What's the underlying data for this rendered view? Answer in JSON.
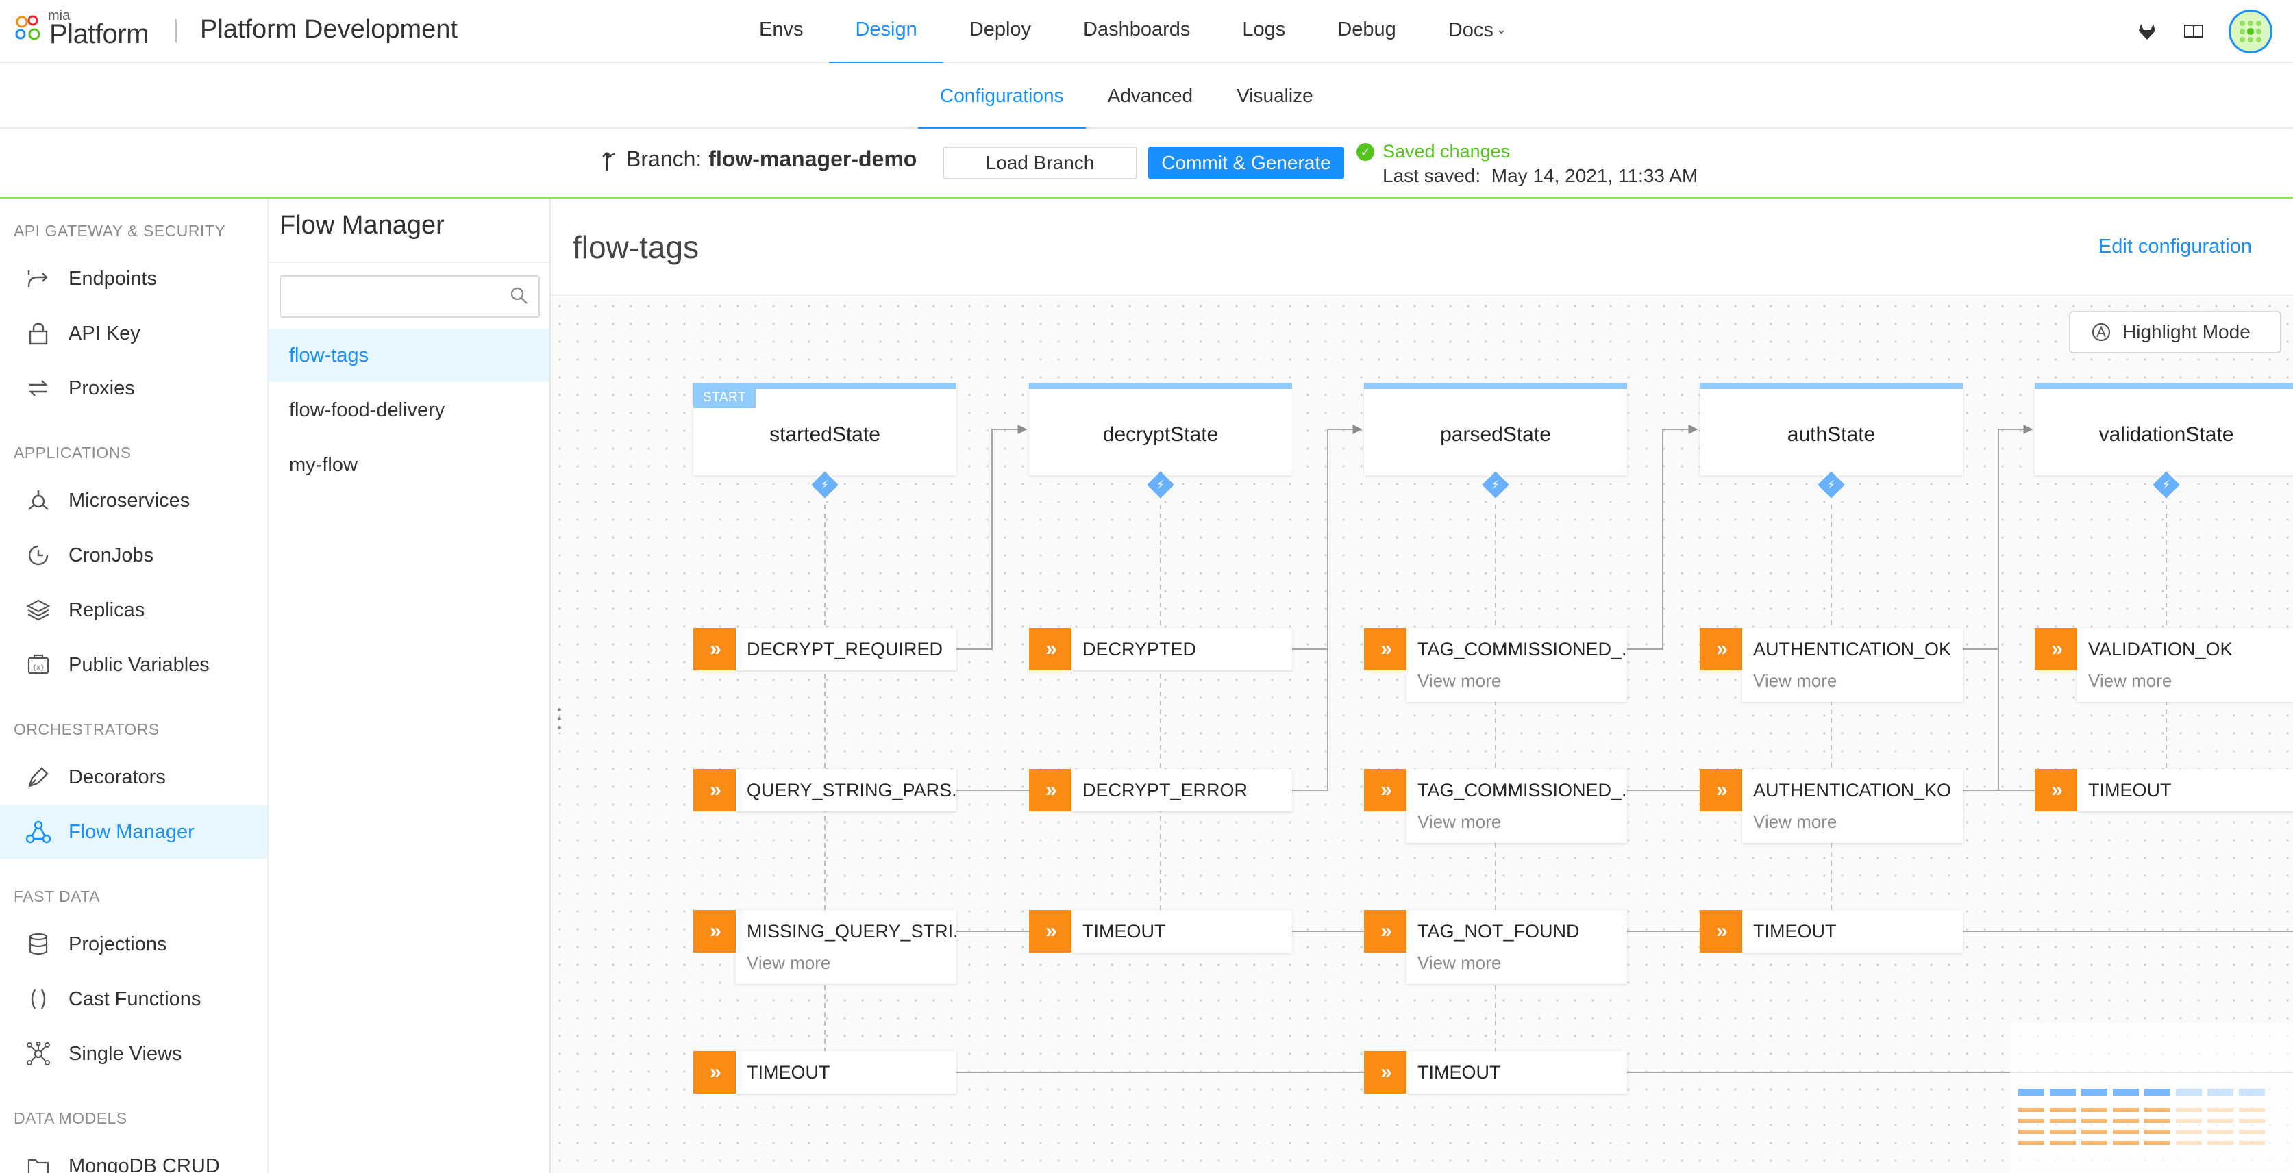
{
  "header": {
    "logo_small": "mia",
    "logo_main": "Platform",
    "project": "Platform Development",
    "nav": [
      "Envs",
      "Design",
      "Deploy",
      "Dashboards",
      "Logs",
      "Debug",
      "Docs"
    ],
    "nav_active": "Design",
    "icons": [
      "gitlab-icon",
      "book-icon",
      "avatar"
    ]
  },
  "subtabs": {
    "items": [
      "Configurations",
      "Advanced",
      "Visualize"
    ],
    "active": "Configurations"
  },
  "branch": {
    "label": "Branch:",
    "name": "flow-manager-demo",
    "load_label": "Load Branch",
    "commit_label": "Commit & Generate",
    "saved_text": "Saved changes",
    "last_saved_label": "Last saved:",
    "last_saved_value": "May 14, 2021, 11:33 AM"
  },
  "sidebar": {
    "sections": [
      {
        "title": "API GATEWAY & SECURITY",
        "items": [
          "Endpoints",
          "API Key",
          "Proxies"
        ]
      },
      {
        "title": "APPLICATIONS",
        "items": [
          "Microservices",
          "CronJobs",
          "Replicas",
          "Public Variables"
        ]
      },
      {
        "title": "ORCHESTRATORS",
        "items": [
          "Decorators",
          "Flow Manager"
        ]
      },
      {
        "title": "FAST DATA",
        "items": [
          "Projections",
          "Cast Functions",
          "Single Views"
        ]
      },
      {
        "title": "DATA MODELS",
        "items": [
          "MongoDB CRUD"
        ]
      }
    ],
    "active": "Flow Manager"
  },
  "flowlist": {
    "title": "Flow Manager",
    "search_placeholder": "",
    "items": [
      "flow-tags",
      "flow-food-delivery",
      "my-flow"
    ],
    "active": "flow-tags"
  },
  "main": {
    "title": "flow-tags",
    "edit_label": "Edit configuration",
    "highlight_label": "Highlight Mode"
  },
  "graph": {
    "start_badge": "START",
    "view_more": "View more",
    "states": [
      {
        "name": "startedState",
        "start": true,
        "events": [
          {
            "label": "DECRYPT_REQUIRED",
            "more": false
          },
          {
            "label": "QUERY_STRING_PARS...",
            "more": false
          },
          {
            "label": "MISSING_QUERY_STRI...",
            "more": true
          },
          {
            "label": "TIMEOUT",
            "more": false
          }
        ]
      },
      {
        "name": "decryptState",
        "start": false,
        "events": [
          {
            "label": "DECRYPTED",
            "more": false
          },
          {
            "label": "DECRYPT_ERROR",
            "more": false
          },
          {
            "label": "TIMEOUT",
            "more": false
          }
        ]
      },
      {
        "name": "parsedState",
        "start": false,
        "events": [
          {
            "label": "TAG_COMMISSIONED_...",
            "more": true
          },
          {
            "label": "TAG_COMMISSIONED_...",
            "more": true
          },
          {
            "label": "TAG_NOT_FOUND",
            "more": true
          },
          {
            "label": "TIMEOUT",
            "more": false
          }
        ]
      },
      {
        "name": "authState",
        "start": false,
        "events": [
          {
            "label": "AUTHENTICATION_OK",
            "more": true
          },
          {
            "label": "AUTHENTICATION_KO",
            "more": true
          },
          {
            "label": "TIMEOUT",
            "more": false
          }
        ]
      },
      {
        "name": "validationState",
        "start": false,
        "events": [
          {
            "label": "VALIDATION_OK",
            "more": true
          },
          {
            "label": "TIMEOUT",
            "more": false
          }
        ]
      }
    ]
  },
  "colors": {
    "accent": "#1890ff",
    "event": "#fa8c16",
    "state_top": "#91caff",
    "saved": "#52c41a"
  }
}
